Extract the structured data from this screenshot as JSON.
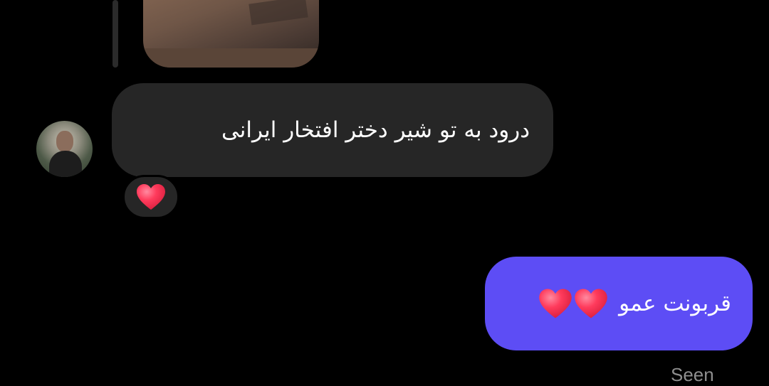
{
  "thread": {
    "incoming_message": {
      "text": "درود به تو شیر دختر افتخار ایرانی",
      "reaction_icon": "red-heart-emoji"
    },
    "outgoing_message": {
      "text": "قربونت عمو",
      "emoji_icons": [
        "red-heart-emoji",
        "red-heart-emoji"
      ]
    },
    "status": "Seen"
  },
  "colors": {
    "background": "#000000",
    "incoming_bubble": "#262626",
    "outgoing_bubble": "#5d4df5",
    "heart": "#ff3b5c",
    "status_text": "#8e8e8e"
  }
}
